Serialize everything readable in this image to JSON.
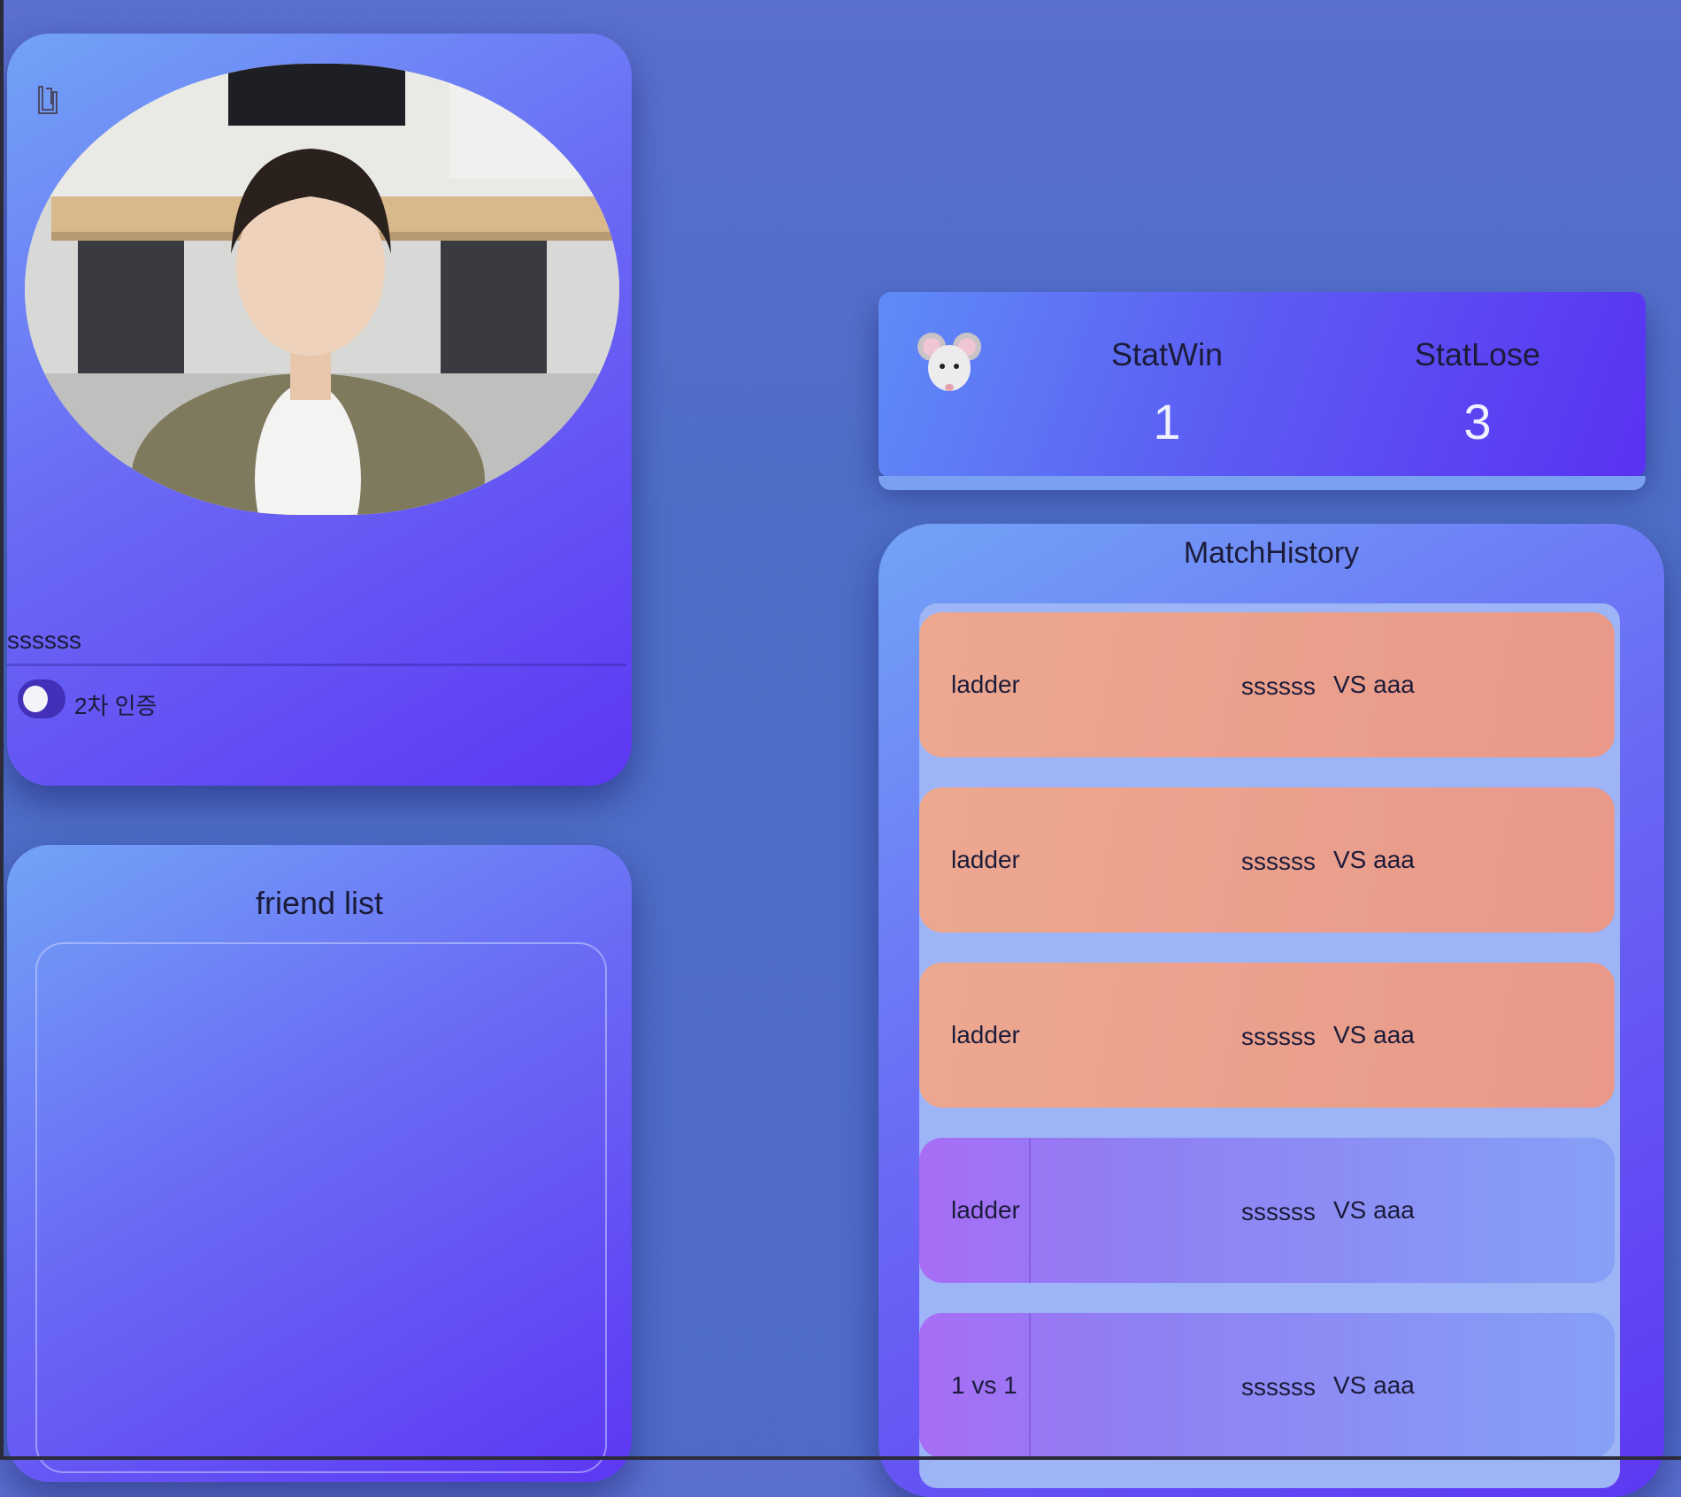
{
  "profile": {
    "username": "ssssss",
    "twofa_label": "2차 인증",
    "twofa_enabled": false
  },
  "friends": {
    "title": "friend list",
    "items": []
  },
  "stats": {
    "win_label": "StatWin",
    "win_value": "1",
    "lose_label": "StatLose",
    "lose_value": "3"
  },
  "history": {
    "title": "MatchHistory",
    "matches": [
      {
        "mode": "ladder",
        "player": "ssssss",
        "opponent": "VS aaa",
        "result": "lose"
      },
      {
        "mode": "ladder",
        "player": "ssssss",
        "opponent": "VS aaa",
        "result": "lose"
      },
      {
        "mode": "ladder",
        "player": "ssssss",
        "opponent": "VS aaa",
        "result": "lose"
      },
      {
        "mode": "ladder",
        "player": "ssssss",
        "opponent": "VS aaa",
        "result": "win"
      },
      {
        "mode": "1 vs 1",
        "player": "ssssss",
        "opponent": "VS aaa",
        "result": "win"
      }
    ]
  },
  "colors": {
    "lose_row": "#eda890",
    "win_row": "#a86df5",
    "card_accent": "#5d37f3"
  },
  "icons": [
    "edit-icon",
    "mouse-icon",
    "toggle-switch"
  ]
}
